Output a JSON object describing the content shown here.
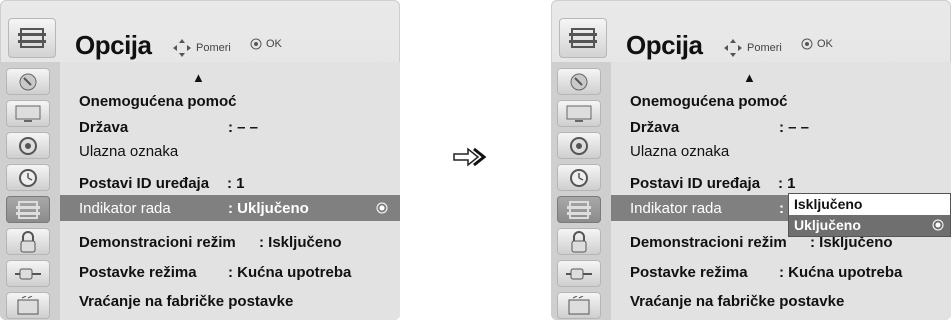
{
  "header": {
    "title": "Opcija",
    "move_hint": "Pomeri",
    "ok_hint": "OK"
  },
  "left": {
    "rows": [
      {
        "label": "Onemogućena pomoć",
        "value": ""
      },
      {
        "label": "Država",
        "value": ": – –"
      },
      {
        "label": "Ulazna oznaka",
        "value": ""
      },
      {
        "label": "Postavi ID uređaja",
        "value": ": 1"
      },
      {
        "label": "Indikator rada",
        "value": ": Uključeno"
      },
      {
        "label": "Demonstracioni režim",
        "value": ": Isključeno"
      },
      {
        "label": "Postavke režima",
        "value": ": Kućna upotreba"
      },
      {
        "label": "Vraćanje na fabričke postavke",
        "value": ""
      }
    ]
  },
  "right": {
    "rows": [
      {
        "label": "Onemogućena pomoć",
        "value": ""
      },
      {
        "label": "Država",
        "value": ": – –"
      },
      {
        "label": "Ulazna oznaka",
        "value": ""
      },
      {
        "label": "Postavi ID uređaja",
        "value": ": 1"
      },
      {
        "label": "Indikator rada",
        "value": ": U"
      },
      {
        "label": "Demonstracioni režim",
        "value": ": Isključeno"
      },
      {
        "label": "Postavke režima",
        "value": ": Kućna upotreba"
      },
      {
        "label": "Vraćanje na fabričke postavke",
        "value": ""
      }
    ],
    "dropdown": {
      "options": [
        "Isključeno",
        "Uključeno"
      ],
      "selected": "Uključeno"
    }
  },
  "sidebar_icons": [
    "satellite-icon",
    "monitor-icon",
    "speaker-icon",
    "clock-icon",
    "option-icon",
    "lock-icon",
    "input-icon",
    "usb-icon"
  ],
  "colors": {
    "highlight": "#808080",
    "panel": "#e2e2e2"
  }
}
